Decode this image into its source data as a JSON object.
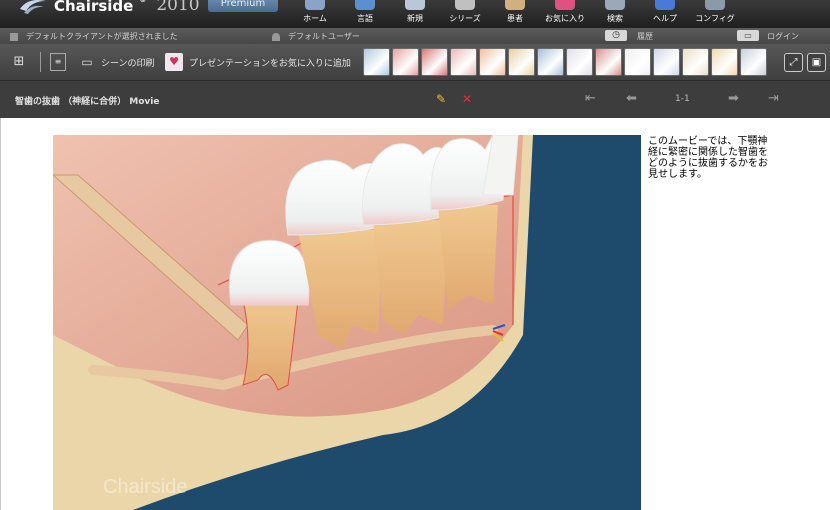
{
  "app": {
    "logo_text": "Chairside",
    "logo_sup": "®",
    "logo_year": "2010",
    "edition": "Premium"
  },
  "nav": [
    {
      "label": "ホーム",
      "icon": "home-icon",
      "color": "#8aa4c8"
    },
    {
      "label": "言語",
      "icon": "language-icon",
      "color": "#5a8fd0"
    },
    {
      "label": "新規",
      "icon": "new-icon",
      "color": "#b8c8d8"
    },
    {
      "label": "シリーズ",
      "icon": "series-icon",
      "color": "#c0c0c0"
    },
    {
      "label": "患者",
      "icon": "patient-icon",
      "color": "#d0b080"
    },
    {
      "label": "お気に入り",
      "icon": "favorites-icon",
      "color": "#e05080"
    },
    {
      "label": "検索",
      "icon": "search-icon",
      "color": "#9aa8b8"
    },
    {
      "label": "ヘルプ",
      "icon": "help-icon",
      "color": "#4a7ad8"
    },
    {
      "label": "コンフィグ",
      "icon": "config-icon",
      "color": "#8a9aa8"
    }
  ],
  "status": {
    "client": "デフォルトクライアントが選択されました",
    "user": "デフォルトユーザー",
    "history": "履歴",
    "login": "ログイン"
  },
  "toolbar": {
    "print_scene": "シーンの印刷",
    "add_favorite": "プレゼンテーションをお気に入りに追加"
  },
  "thumbnail_colors": [
    "#b0c8e0",
    "#e8a0a0",
    "#d87878",
    "#e8b8b8",
    "#f0c0a0",
    "#e8d0a0",
    "#a8c0d8",
    "#e0e0e8",
    "#d89090",
    "#f0f0f0",
    "#d0d8e8",
    "#e8e0c8",
    "#f0d8b0",
    "#c8d0d8"
  ],
  "presentation": {
    "title": "智歯の抜歯 （神経に合併） Movie",
    "page": "1-1",
    "description": "このムービーでは、下顎神経に緊密に関係した智歯をどのように抜歯するかをお見せします。",
    "watermark": "Chairside"
  },
  "colors": {
    "video_bg": "#1e4a6c",
    "gum": "#e8a89a",
    "bone": "#e8d2a0",
    "root": "#e8b87a",
    "enamel": "#f8f8f6"
  }
}
